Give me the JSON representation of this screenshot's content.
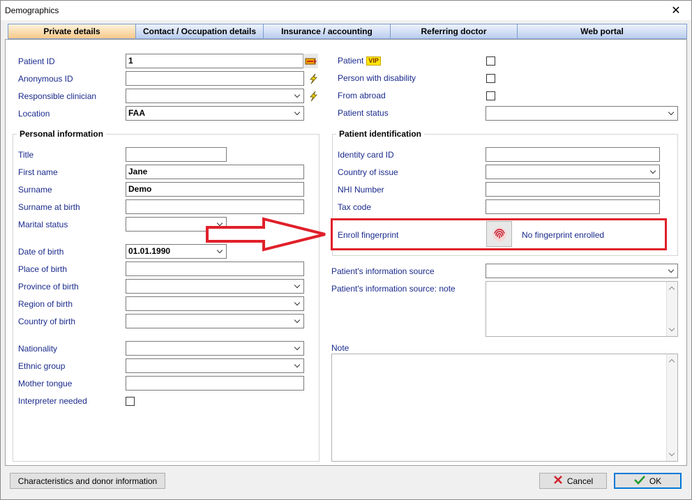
{
  "window": {
    "title": "Demographics"
  },
  "tabs": [
    {
      "label": "Private details",
      "active": true
    },
    {
      "label": "Contact / Occupation details",
      "active": false
    },
    {
      "label": "Insurance / accounting",
      "active": false
    },
    {
      "label": "Referring doctor",
      "active": false
    },
    {
      "label": "Web portal",
      "active": false
    }
  ],
  "top_left": {
    "patient_id_label": "Patient ID",
    "patient_id_value": "1",
    "anonymous_id_label": "Anonymous ID",
    "anonymous_id_value": "",
    "responsible_clinician_label": "Responsible clinician",
    "responsible_clinician_value": "",
    "location_label": "Location",
    "location_value": "FAA"
  },
  "top_right": {
    "patient_label": "Patient",
    "vip_badge": "VIP",
    "disability_label": "Person with disability",
    "abroad_label": "From abroad",
    "status_label": "Patient status",
    "status_value": ""
  },
  "personal": {
    "title": "Personal information",
    "title_label": "Title",
    "title_value": "",
    "first_name_label": "First name",
    "first_name_value": "Jane",
    "surname_label": "Surname",
    "surname_value": "Demo",
    "surname_birth_label": "Surname at birth",
    "surname_birth_value": "",
    "marital_label": "Marital status",
    "marital_value": "",
    "dob_label": "Date of birth",
    "dob_value": "01.01.1990",
    "place_birth_label": "Place of birth",
    "province_birth_label": "Province of birth",
    "region_birth_label": "Region of birth",
    "country_birth_label": "Country of birth",
    "nationality_label": "Nationality",
    "ethnic_label": "Ethnic group",
    "mother_tongue_label": "Mother tongue",
    "interpreter_label": "Interpreter needed"
  },
  "identification": {
    "title": "Patient identification",
    "identity_card_label": "Identity card ID",
    "country_issue_label": "Country of issue",
    "nhi_label": "NHI Number",
    "tax_label": "Tax code",
    "fingerprint_label": "Enroll fingerprint",
    "fingerprint_status": "No fingerprint enrolled"
  },
  "info_source": {
    "source_label": "Patient's information source",
    "source_note_label": "Patient's information source: note",
    "note_label": "Note"
  },
  "footer": {
    "characteristics_button": "Characteristics and donor information",
    "cancel_button": "Cancel",
    "ok_button": "OK"
  },
  "colors": {
    "label_blue": "#1a2a8c",
    "highlight_red": "#e0202a",
    "tab_active": "#f6c98a"
  }
}
